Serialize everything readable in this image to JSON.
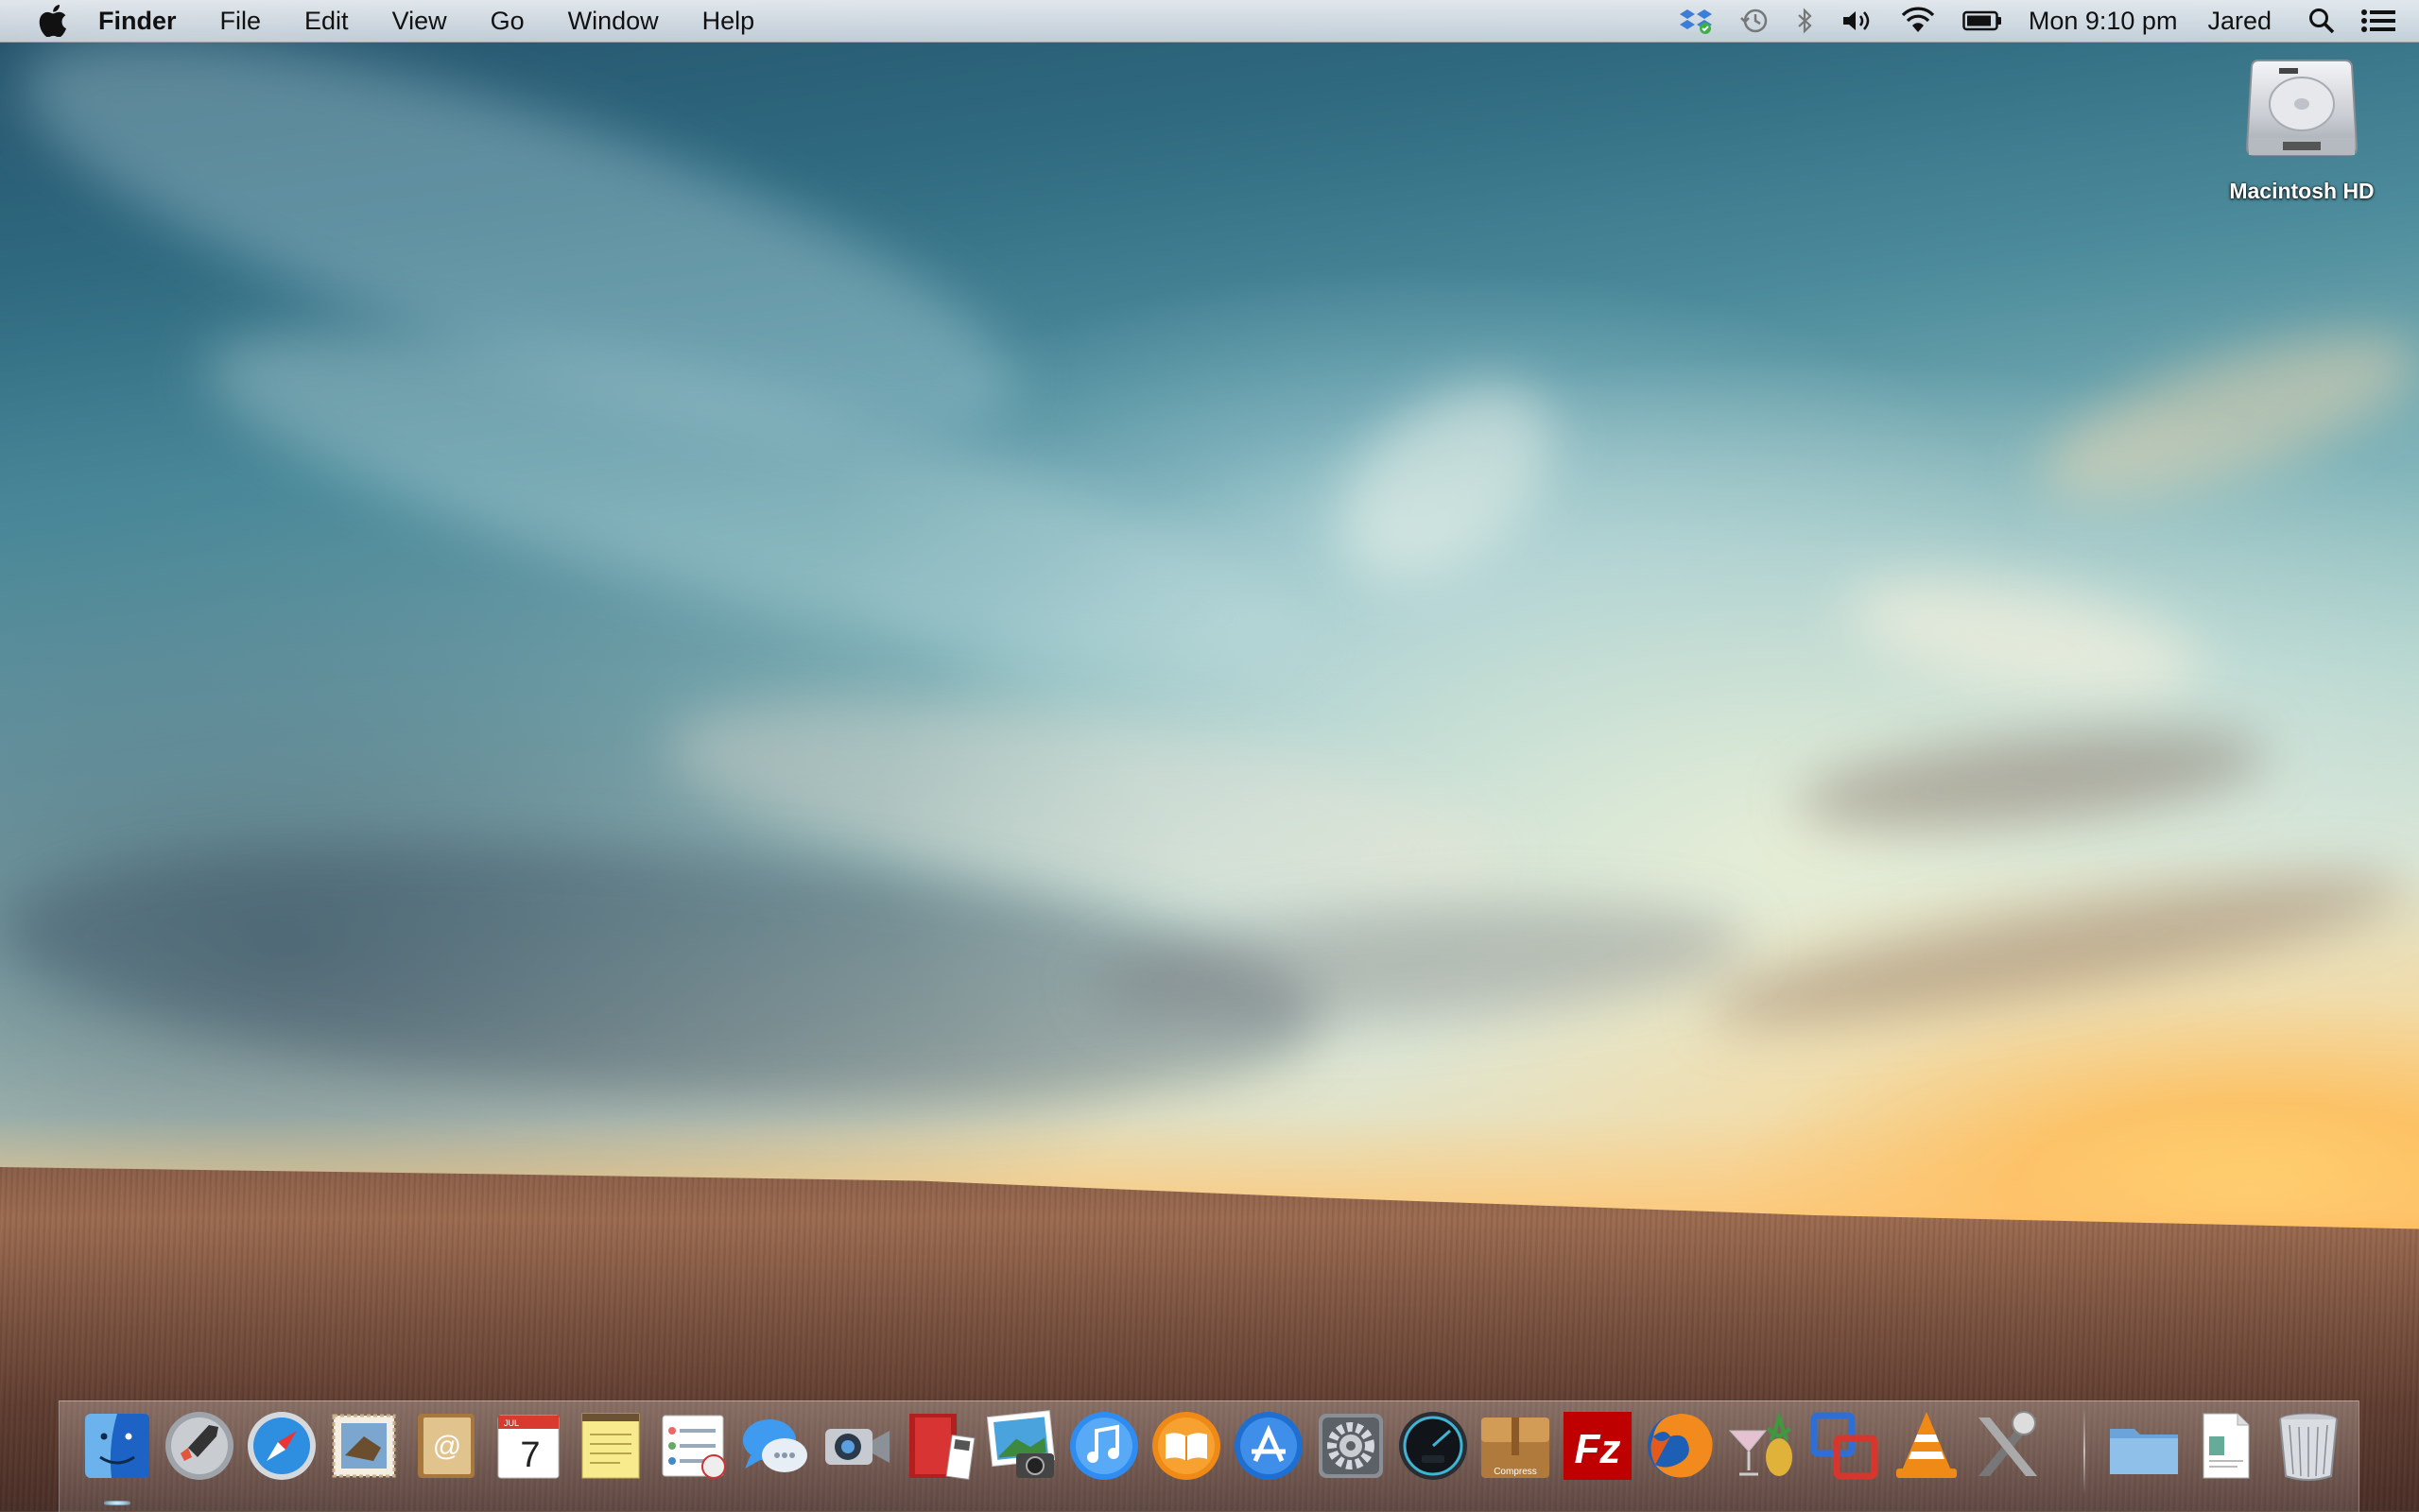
{
  "menubar": {
    "app_name": "Finder",
    "menus": [
      "File",
      "Edit",
      "View",
      "Go",
      "Window",
      "Help"
    ],
    "status_icons": [
      "dropbox-icon",
      "time-machine-icon",
      "bluetooth-icon",
      "volume-icon",
      "wifi-icon",
      "battery-icon"
    ],
    "clock": "Mon 9:10 pm",
    "user": "Jared",
    "right_icons": [
      "spotlight-icon",
      "notification-center-icon"
    ]
  },
  "desktop": {
    "items": [
      {
        "label": "Macintosh HD",
        "icon": "hard-drive-icon"
      }
    ]
  },
  "dock": {
    "apps": [
      {
        "icon": "finder-icon",
        "running": true
      },
      {
        "icon": "launchpad-icon",
        "running": false
      },
      {
        "icon": "safari-icon",
        "running": false
      },
      {
        "icon": "mail-icon",
        "running": false
      },
      {
        "icon": "contacts-icon",
        "running": false
      },
      {
        "icon": "calendar-icon",
        "running": false,
        "text": "7",
        "month": "JUL"
      },
      {
        "icon": "notes-icon",
        "running": false
      },
      {
        "icon": "reminders-icon",
        "running": false
      },
      {
        "icon": "messages-icon",
        "running": false
      },
      {
        "icon": "facetime-icon",
        "running": false
      },
      {
        "icon": "photo-booth-icon",
        "running": false
      },
      {
        "icon": "iphoto-icon",
        "running": false
      },
      {
        "icon": "itunes-icon",
        "running": false
      },
      {
        "icon": "ibooks-icon",
        "running": false
      },
      {
        "icon": "app-store-icon",
        "running": false
      },
      {
        "icon": "system-preferences-icon",
        "running": false
      },
      {
        "icon": "istat-menus-icon",
        "running": false
      },
      {
        "icon": "archive-utility-icon",
        "running": false,
        "text": "Compress"
      },
      {
        "icon": "filezilla-icon",
        "running": false,
        "text": "Fz"
      },
      {
        "icon": "firefox-icon",
        "running": false
      },
      {
        "icon": "cocktail-icon",
        "running": false
      },
      {
        "icon": "connection-app-icon",
        "running": false
      },
      {
        "icon": "vlc-icon",
        "running": false
      },
      {
        "icon": "x11-icon",
        "running": false
      }
    ],
    "stacks": [
      {
        "icon": "folder-stack-icon"
      },
      {
        "icon": "documents-stack-icon"
      }
    ],
    "trash": {
      "icon": "trash-icon"
    }
  },
  "colors": {
    "menubar_text": "#111111",
    "sky_top": "#24516a",
    "sunset": "#f6b864",
    "field": "#7e5541"
  }
}
